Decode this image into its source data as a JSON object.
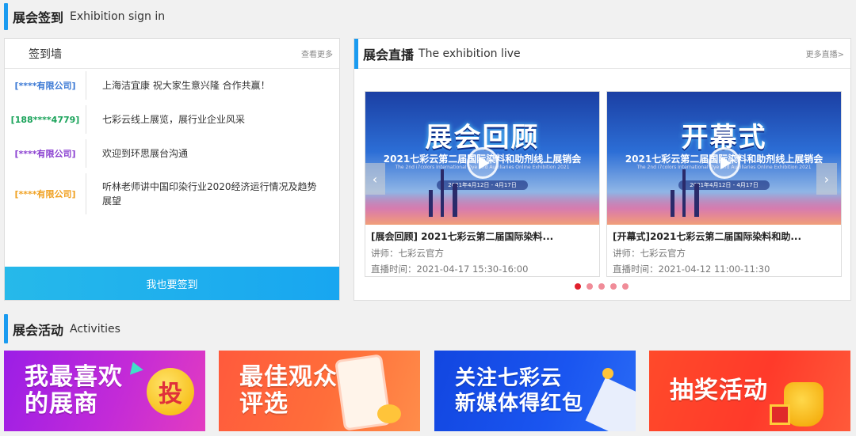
{
  "signin_section": {
    "title_zh": "展会签到",
    "title_en": "Exhibition sign in"
  },
  "signwall": {
    "title": "签到墙",
    "more": "查看更多",
    "entries": [
      {
        "who": "[****有限公司]",
        "msg": "上海洁宜康 祝大家生意兴隆 合作共赢！",
        "color": "#3a78d4"
      },
      {
        "who": "[188****4779]",
        "msg": "七彩云线上展览，展行业企业风采",
        "color": "#1aa35a"
      },
      {
        "who": "[****有限公司]",
        "msg": "欢迎到环思展台沟通",
        "color": "#8a3fd0"
      },
      {
        "who": "[****有限公司]",
        "msg": "听林老师讲中国印染行业2020经济运行情况及趋势展望",
        "color": "#f0a020"
      }
    ],
    "button": "我也要签到"
  },
  "live_section": {
    "title_zh": "展会直播",
    "title_en": "The exhibition live",
    "more": "更多直播>"
  },
  "live_cards": [
    {
      "banner_big": "展会回顾",
      "banner_sub": "2021七彩云第二届国际染料和助剂线上展销会",
      "banner_sub_en": "The 2nd i7colors International Dye and Auxiliaries Online Exhibition 2021",
      "banner_date": "2021年4月12日 - 4月17日",
      "title": "[展会回顾] 2021七彩云第二届国际染料...",
      "lecturer": "讲师：七彩云官方",
      "time": "直播时间：2021-04-17 15:30-16:00"
    },
    {
      "banner_big": "开幕式",
      "banner_sub": "2021七彩云第二届国际染料和助剂线上展销会",
      "banner_sub_en": "The 2nd i7colors International Dye and Auxiliaries Online Exhibition 2021",
      "banner_date": "2021年4月12日 - 4月17日",
      "title": "[开幕式]2021七彩云第二届国际染料和助...",
      "lecturer": "讲师：七彩云官方",
      "time": "直播时间：2021-04-12 11:00-11:30"
    }
  ],
  "carousel": {
    "prev": "‹",
    "next": "›",
    "dots": 5,
    "active": 0
  },
  "activities_section": {
    "title_zh": "展会活动",
    "title_en": "Activities"
  },
  "activities": [
    {
      "line1": "我最喜欢",
      "line2": "的展商",
      "badge": "投"
    },
    {
      "line1": "最佳观众",
      "line2": "评选"
    },
    {
      "line1": "关注七彩云",
      "line2": "新媒体得红包"
    },
    {
      "line1": "抽奖活动",
      "line2": ""
    }
  ],
  "colors": {
    "accent": "#1a9bf0",
    "button": "#1ea9ee",
    "dot_active": "#e0202c",
    "dot": "#f08c98"
  }
}
